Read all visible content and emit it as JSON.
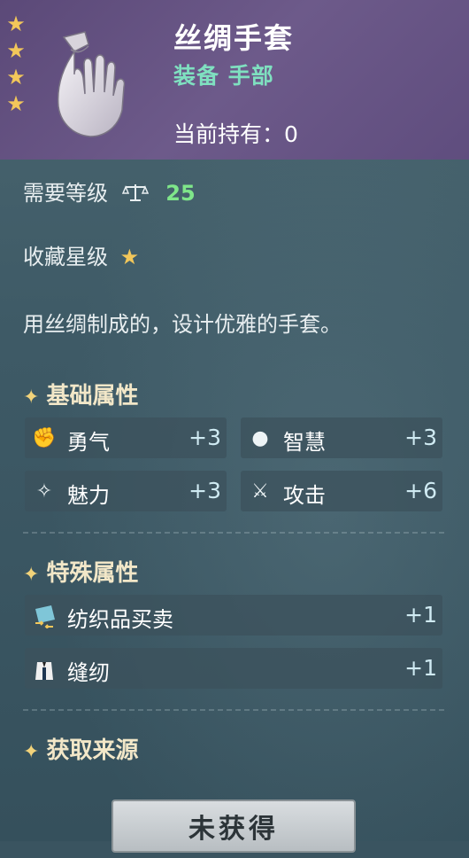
{
  "item": {
    "name": "丝绸手套",
    "type": "装备 手部",
    "owned": "当前持有：0",
    "rarity_stars": 4
  },
  "requirements": {
    "level_label": "需要等级",
    "level_value": "25",
    "collect_label": "收藏星级"
  },
  "description": "用丝绸制成的，设计优雅的手套。",
  "base_attributes": {
    "title": "基础属性",
    "items": [
      {
        "label": "勇气",
        "value": "+3",
        "icon": "fist-icon"
      },
      {
        "label": "智慧",
        "value": "+3",
        "icon": "head-icon"
      },
      {
        "label": "魅力",
        "value": "+3",
        "icon": "sparkle-icon"
      },
      {
        "label": "攻击",
        "value": "+6",
        "icon": "sword-icon"
      }
    ]
  },
  "special_attributes": {
    "title": "特殊属性",
    "items": [
      {
        "label": "纺织品买卖",
        "value": "+1",
        "icon": "fabric-trade-icon"
      },
      {
        "label": "缝纫",
        "value": "+1",
        "icon": "sewing-icon"
      }
    ]
  },
  "source": {
    "title": "获取来源",
    "button_label": "未获得"
  },
  "colors": {
    "header": "#6d5a8a",
    "accent_green": "#7fe0c0",
    "star": "#f2c75a",
    "level": "#7fe68a"
  }
}
